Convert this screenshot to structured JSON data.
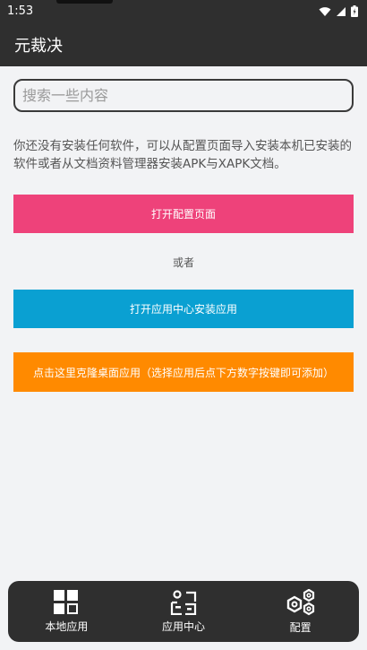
{
  "status_bar": {
    "time": "1:53",
    "icons": [
      "wifi-icon",
      "signal-icon",
      "battery-icon"
    ]
  },
  "app_bar": {
    "title": "元裁决"
  },
  "search": {
    "placeholder": "搜索一些内容"
  },
  "info": {
    "text": "你还没有安装任何软件，可以从配置页面导入安装本机已安装的软件或者从文档资料管理器安装APK与XAPK文档。"
  },
  "actions": {
    "open_config_label": "打开配置页面",
    "or_label": "或者",
    "open_app_center_label": "打开应用中心安装应用",
    "clone_desktop_label": "点击这里克隆桌面应用（选择应用后点下方数字按键即可添加）"
  },
  "bottom_nav": {
    "items": [
      {
        "label": "本地应用",
        "icon": "grid-icon"
      },
      {
        "label": "应用中心",
        "icon": "app-center-icon"
      },
      {
        "label": "配置",
        "icon": "hexagon-settings-icon"
      }
    ]
  },
  "colors": {
    "pink": "#ee427a",
    "blue": "#0aa0d2",
    "orange": "#ff8a00",
    "dark": "#2f2f2f",
    "background": "#f2f3f5"
  }
}
